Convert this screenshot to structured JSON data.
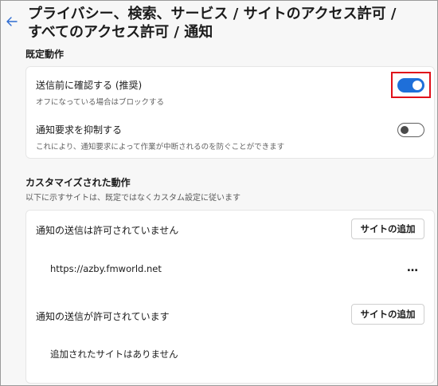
{
  "header": {
    "title_line1": "プライバシー、検索、サービス / サイトのアクセス許可 /",
    "title_line2": "すべてのアクセス許可 / 通知",
    "back_icon": "arrow-left-icon"
  },
  "default_behavior": {
    "heading": "既定動作",
    "items": [
      {
        "label": "送信前に確認する (推奨)",
        "description": "オフになっている場合はブロックする",
        "enabled": true
      },
      {
        "label": "通知要求を抑制する",
        "description": "これにより、通知要求によって作業が中断されるのを防ぐことができます",
        "enabled": false
      }
    ]
  },
  "custom_behavior": {
    "heading": "カスタマイズされた動作",
    "subtitle": "以下に示すサイトは、既定ではなくカスタム設定に従います",
    "blocked": {
      "label": "通知の送信は許可されていません",
      "add_button": "サイトの追加",
      "sites": [
        "https://azby.fmworld.net"
      ],
      "more_label": "…"
    },
    "allowed": {
      "label": "通知の送信が許可されています",
      "add_button": "サイトの追加",
      "empty_text": "追加されたサイトはありません"
    }
  },
  "colors": {
    "accent": "#1e6fd9",
    "highlight_border": "#e0101a"
  }
}
